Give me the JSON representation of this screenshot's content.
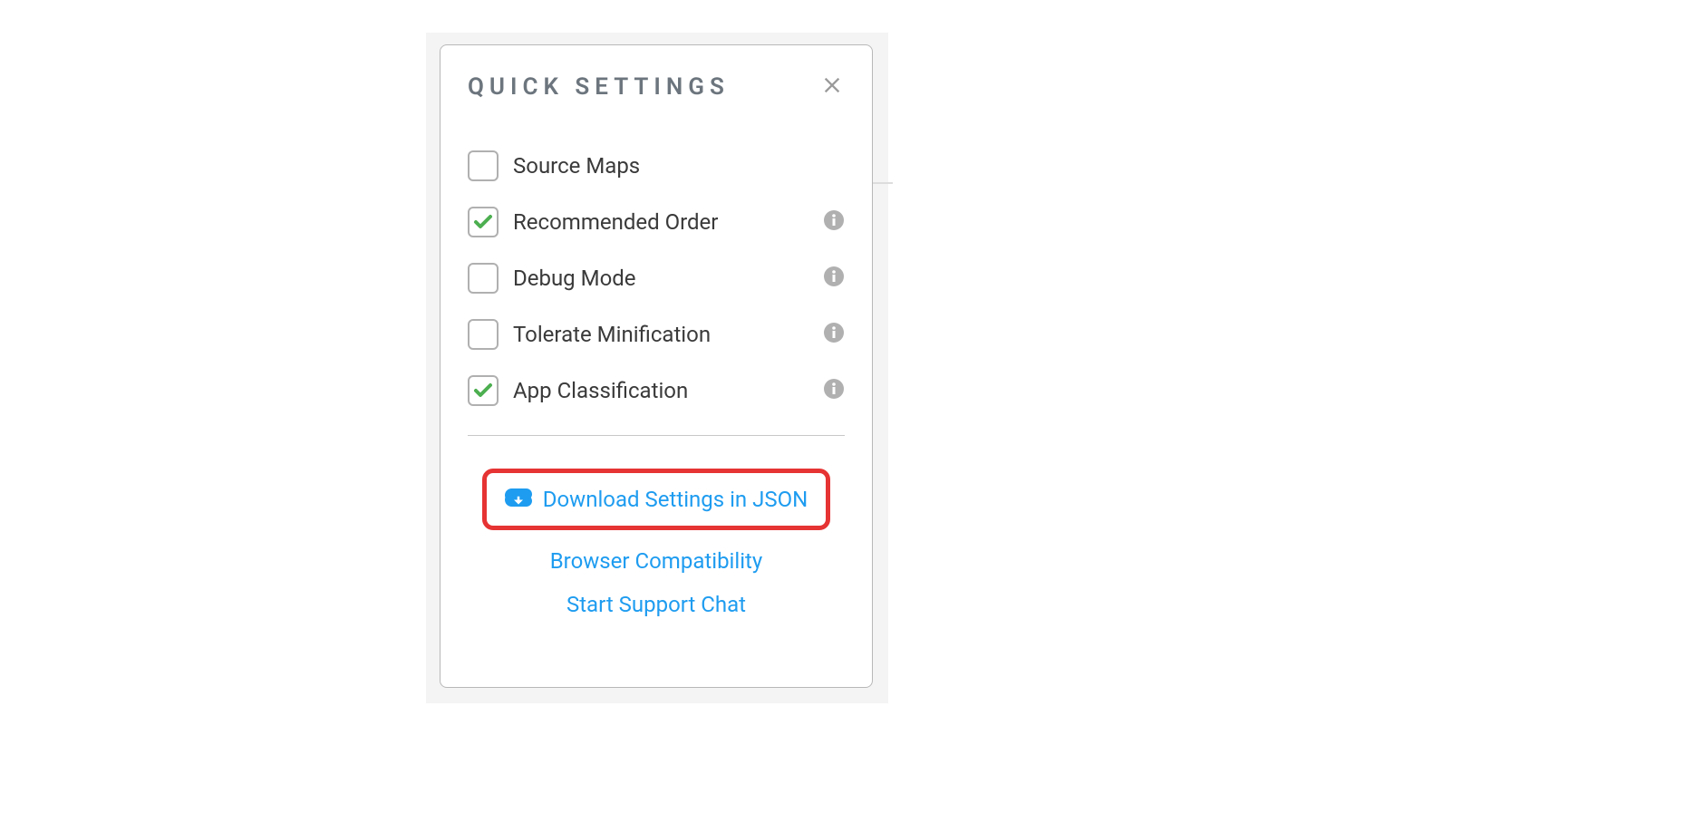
{
  "panel": {
    "title": "QUICK SETTINGS",
    "settings": [
      {
        "label": "Source Maps",
        "checked": false,
        "info": false
      },
      {
        "label": "Recommended Order",
        "checked": true,
        "info": true
      },
      {
        "label": "Debug Mode",
        "checked": false,
        "info": true
      },
      {
        "label": "Tolerate Minification",
        "checked": false,
        "info": true
      },
      {
        "label": "App Classification",
        "checked": true,
        "info": true
      }
    ],
    "links": {
      "download": "Download Settings in JSON",
      "compat": "Browser Compatibility",
      "support": "Start Support Chat"
    }
  }
}
